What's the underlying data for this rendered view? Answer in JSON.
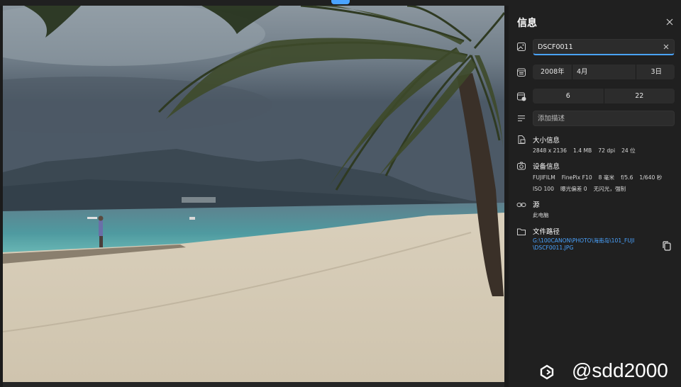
{
  "photo": {
    "alt": "beach-with-palm-tree"
  },
  "panel": {
    "title": "信息",
    "title_field": {
      "value": "DSCF0011"
    },
    "date": {
      "year": "2008年",
      "month": "4月",
      "day": "3日"
    },
    "time": {
      "hour": "6",
      "minute": "22"
    },
    "description": {
      "placeholder": "添加描述"
    },
    "size_info": {
      "heading": "大小信息",
      "values": [
        "2848 x 2136",
        "1.4 MB",
        "72 dpi",
        "24 位"
      ]
    },
    "device_info": {
      "heading": "设备信息",
      "line1": [
        "FUJIFILM",
        "FinePix F10",
        "8 毫米",
        "f/5.6",
        "1/640 秒"
      ],
      "line2": [
        "ISO 100",
        "曝光偏差 0",
        "无闪光，强制"
      ]
    },
    "source": {
      "heading": "源",
      "value": "此电脑"
    },
    "file_path": {
      "heading": "文件路径",
      "line1": "G:\\100CANON\\PHOTO\\海南岛\\101_FUJI",
      "line2": "\\DSCF0011.JPG"
    }
  },
  "watermark": {
    "text": "@sdd2000"
  },
  "colors": {
    "accent": "#4aa3ff",
    "panel_bg": "#202020",
    "field_bg": "#2c2c2c"
  }
}
